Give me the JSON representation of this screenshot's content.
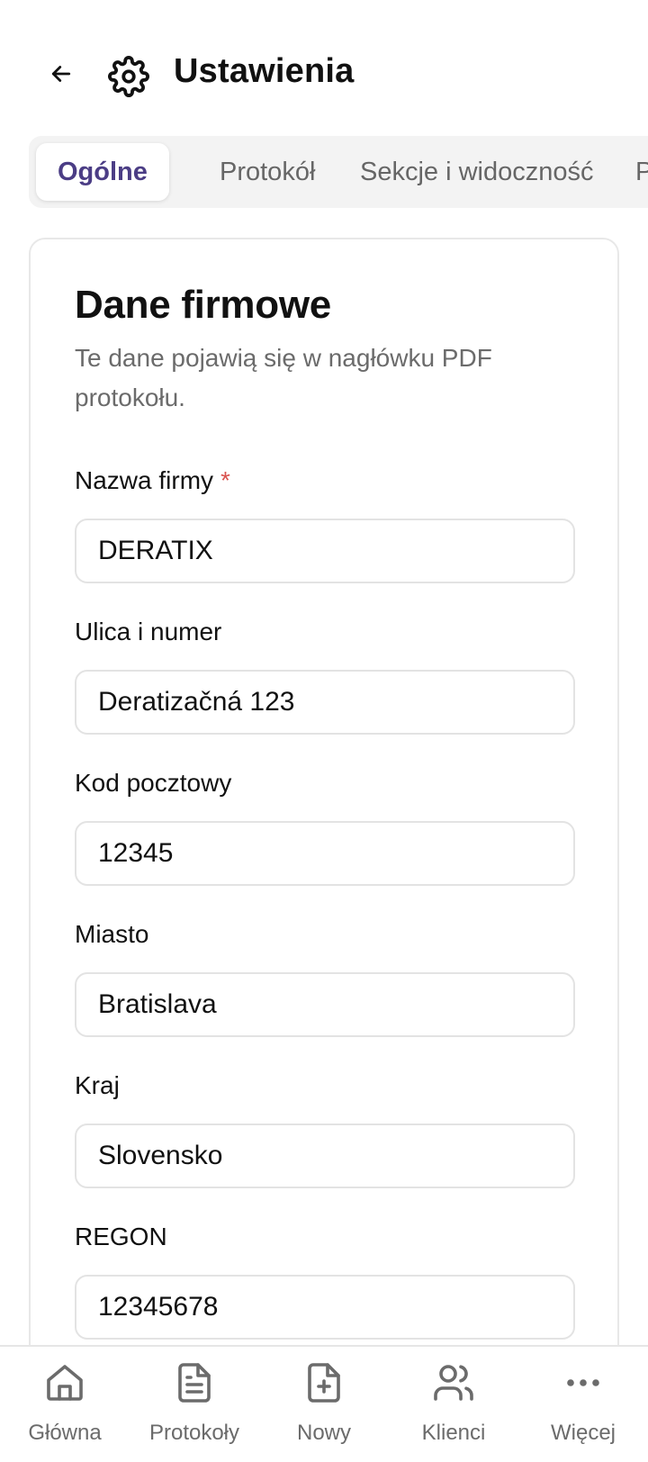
{
  "header": {
    "title": "Ustawienia"
  },
  "tabs": [
    {
      "label": "Ogólne",
      "active": true
    },
    {
      "label": "Protokół",
      "active": false
    },
    {
      "label": "Sekcje i widoczność",
      "active": false
    },
    {
      "label": "Po",
      "active": false
    }
  ],
  "card": {
    "title": "Dane firmowe",
    "description": "Te dane pojawią się w nagłówku PDF protokołu."
  },
  "fields": [
    {
      "label": "Nazwa firmy",
      "required_mark": "*",
      "value": "DERATIX"
    },
    {
      "label": "Ulica i numer",
      "value": "Deratizačná 123"
    },
    {
      "label": "Kod pocztowy",
      "value": "12345"
    },
    {
      "label": "Miasto",
      "value": "Bratislava"
    },
    {
      "label": "Kraj",
      "value": "Slovensko"
    },
    {
      "label": "REGON",
      "value": "12345678"
    }
  ],
  "bottom_nav": [
    {
      "label": "Główna",
      "icon": "home-icon"
    },
    {
      "label": "Protokoły",
      "icon": "document-icon"
    },
    {
      "label": "Nowy",
      "icon": "file-plus-icon"
    },
    {
      "label": "Klienci",
      "icon": "users-icon"
    },
    {
      "label": "Więcej",
      "icon": "more-dots-icon"
    }
  ],
  "colors": {
    "accent": "#4b3d85",
    "required": "#d9534f",
    "muted_text": "#6b6b6b",
    "tab_bg": "#f3f3f3"
  }
}
